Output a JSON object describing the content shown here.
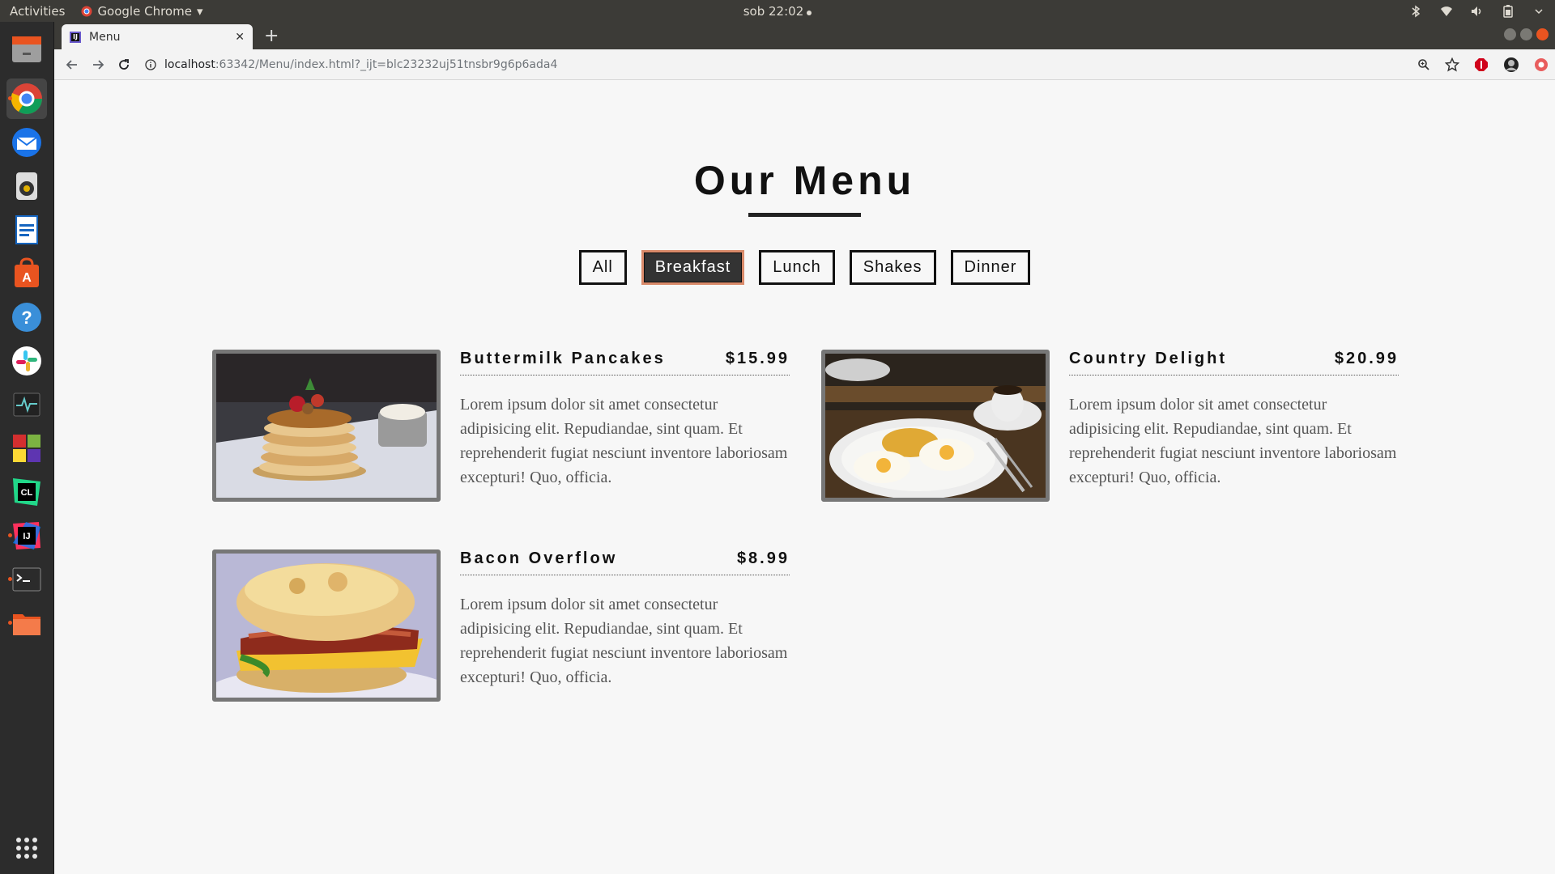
{
  "system": {
    "activities_label": "Activities",
    "app_name": "Google Chrome",
    "clock": "sob 22:02"
  },
  "browser": {
    "tab_title": "Menu",
    "url_host": "localhost",
    "url_rest": ":63342/Menu/index.html?_ijt=blc23232uj51tnsbr9g6p6ada4"
  },
  "page": {
    "title": "Our Menu",
    "filters": [
      {
        "label": "All",
        "active": false
      },
      {
        "label": "Breakfast",
        "active": true
      },
      {
        "label": "Lunch",
        "active": false
      },
      {
        "label": "Shakes",
        "active": false
      },
      {
        "label": "Dinner",
        "active": false
      }
    ],
    "items": [
      {
        "name": "Buttermilk Pancakes",
        "price": "$15.99",
        "image": "pancakes-photo",
        "description": "Lorem ipsum dolor sit amet consectetur adipisicing elit. Repudiandae, sint quam. Et reprehenderit fugiat nesciunt inventore laboriosam excepturi! Quo, officia."
      },
      {
        "name": "Country Delight",
        "price": "$20.99",
        "image": "eggs-plate-photo",
        "description": "Lorem ipsum dolor sit amet consectetur adipisicing elit. Repudiandae, sint quam. Et reprehenderit fugiat nesciunt inventore laboriosam excepturi! Quo, officia."
      },
      {
        "name": "Bacon Overflow",
        "price": "$8.99",
        "image": "bacon-sandwich-photo",
        "description": "Lorem ipsum dolor sit amet consectetur adipisicing elit. Repudiandae, sint quam. Et reprehenderit fugiat nesciunt inventore laboriosam excepturi! Quo, officia."
      }
    ]
  },
  "colors": {
    "accent": "#e95420",
    "page_bg": "#f7f7f7",
    "active_filter_bg": "#333333"
  }
}
